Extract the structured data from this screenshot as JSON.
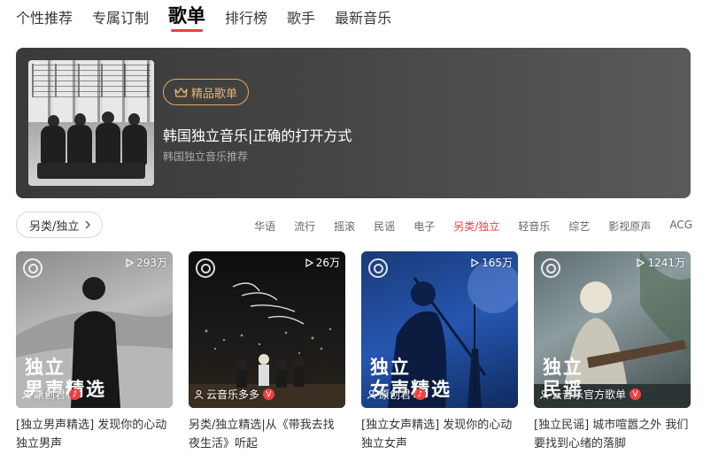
{
  "nav": {
    "items": [
      {
        "label": "个性推荐"
      },
      {
        "label": "专属订制"
      },
      {
        "label": "歌单"
      },
      {
        "label": "排行榜"
      },
      {
        "label": "歌手"
      },
      {
        "label": "最新音乐"
      }
    ],
    "active_index": 2
  },
  "banner": {
    "badge": "精品歌单",
    "title": "韩国独立音乐|正确的打开方式",
    "subtitle": "韩国独立音乐推荐",
    "badge_color": "#f0b26b"
  },
  "filter": {
    "current_category": "另类/独立",
    "tags": [
      "华语",
      "流行",
      "摇滚",
      "民谣",
      "电子",
      "另类/独立",
      "轻音乐",
      "综艺",
      "影视原声",
      "ACG"
    ],
    "active_tag": "另类/独立",
    "accent_color": "#ec4141"
  },
  "playlists": [
    {
      "plays": "293万",
      "cover_text": "独立\n男声精选",
      "creator": "原创君",
      "creator_badge": "music-badge-icon",
      "title": "[独立男声精选] 发现你的心动独立男声"
    },
    {
      "plays": "26万",
      "cover_text": "",
      "creator": "云音乐多多",
      "creator_badge": "V",
      "title": "另类/独立精选|从《带我去找夜生活》听起"
    },
    {
      "plays": "165万",
      "cover_text": "独立\n女声精选",
      "creator": "原创君",
      "creator_badge": "music-badge-icon",
      "title": "[独立女声精选] 发现你的心动独立女声"
    },
    {
      "plays": "1241万",
      "cover_text": "独立\n民谣",
      "creator": "云音乐官方歌单",
      "creator_badge": "V",
      "title": "[独立民谣] 城市喧嚣之外 我们要找到心绪的落脚"
    }
  ]
}
